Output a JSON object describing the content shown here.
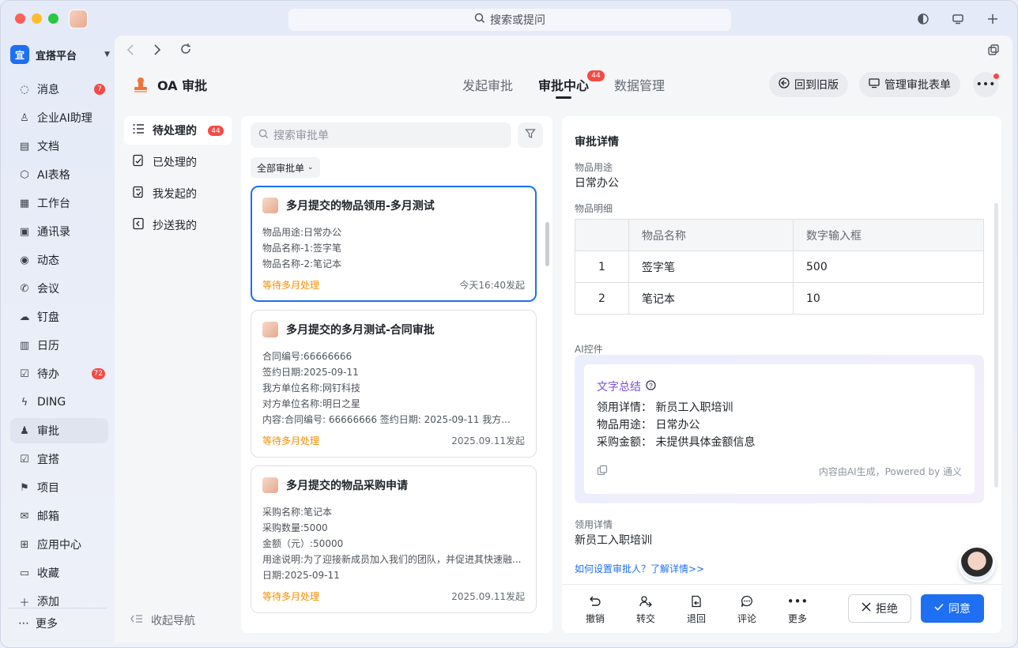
{
  "titlebar": {
    "search_placeholder": "搜索或提问"
  },
  "org": {
    "logo_char": "宜",
    "name": "宜搭平台"
  },
  "sidebar": {
    "items": [
      {
        "label": "消息",
        "icon": "chat-icon",
        "badge": "7"
      },
      {
        "label": "企业AI助理",
        "icon": "person-icon",
        "badge": ""
      },
      {
        "label": "文档",
        "icon": "doc-icon",
        "badge": ""
      },
      {
        "label": "AI表格",
        "icon": "cube-icon",
        "badge": ""
      },
      {
        "label": "工作台",
        "icon": "grid-icon",
        "badge": ""
      },
      {
        "label": "通讯录",
        "icon": "contacts-icon",
        "badge": ""
      },
      {
        "label": "动态",
        "icon": "eye-icon",
        "badge": ""
      },
      {
        "label": "会议",
        "icon": "phone-icon",
        "badge": ""
      },
      {
        "label": "钉盘",
        "icon": "cloud-icon",
        "badge": ""
      },
      {
        "label": "日历",
        "icon": "calendar-icon",
        "badge": ""
      },
      {
        "label": "待办",
        "icon": "check-icon",
        "badge": "72"
      },
      {
        "label": "DING",
        "icon": "bolt-icon",
        "badge": ""
      },
      {
        "label": "审批",
        "icon": "stamp-icon",
        "badge": ""
      },
      {
        "label": "宜搭",
        "icon": "checkbox-icon",
        "badge": ""
      },
      {
        "label": "项目",
        "icon": "flag-icon",
        "badge": ""
      },
      {
        "label": "邮箱",
        "icon": "mail-icon",
        "badge": ""
      },
      {
        "label": "应用中心",
        "icon": "apps-icon",
        "badge": ""
      },
      {
        "label": "收藏",
        "icon": "box-icon",
        "badge": ""
      },
      {
        "label": "添加",
        "icon": "plus-icon",
        "badge": ""
      }
    ],
    "more_label": "更多"
  },
  "app": {
    "title": "OA 审批",
    "tabs": [
      {
        "label": "发起审批"
      },
      {
        "label": "审批中心",
        "badge": "44"
      },
      {
        "label": "数据管理"
      }
    ],
    "back_old_label": "回到旧版",
    "manage_forms_label": "管理审批表单"
  },
  "subnav": {
    "items": [
      {
        "label": "待处理的",
        "badge": "44"
      },
      {
        "label": "已处理的"
      },
      {
        "label": "我发起的"
      },
      {
        "label": "抄送我的"
      }
    ],
    "collapse_label": "收起导航"
  },
  "list": {
    "search_placeholder": "搜索审批单",
    "filter_label": "全部审批单",
    "cards": [
      {
        "title": "多月提交的物品领用-多月测试",
        "lines": [
          "物品用途:日常办公",
          "物品名称-1:签字笔",
          "物品名称-2:笔记本"
        ],
        "status": "等待多月处理",
        "time": "今天16:40发起"
      },
      {
        "title": "多月提交的多月测试-合同审批",
        "lines": [
          "合同编号:66666666",
          "签约日期:2025-09-11",
          "我方单位名称:网钉科技",
          "对方单位名称:明日之星",
          "内容:合同编号: 66666666 签约日期: 2025-09-11 我方..."
        ],
        "status": "等待多月处理",
        "time": "2025.09.11发起"
      },
      {
        "title": "多月提交的物品采购申请",
        "lines": [
          "采购名称:笔记本",
          "采购数量:5000",
          "金额（元）:50000",
          "用途说明:为了迎接新成员加入我们的团队，并促进其快速融...",
          "日期:2025-09-11"
        ],
        "status": "等待多月处理",
        "time": "2025.09.11发起"
      }
    ]
  },
  "detail": {
    "heading": "审批详情",
    "usage_label": "物品用途",
    "usage_value": "日常办公",
    "items_label": "物品明细",
    "table": {
      "headers": [
        "",
        "物品名称",
        "数字输入框"
      ],
      "rows": [
        [
          "1",
          "签字笔",
          "500"
        ],
        [
          "2",
          "笔记本",
          "10"
        ]
      ]
    },
    "ai_label": "AI控件",
    "ai": {
      "title": "文字总结",
      "lines": [
        "领用详情： 新员工入职培训",
        "物品用途： 日常办公",
        "采购金额： 未提供具体金额信息"
      ],
      "powered": "内容由AI生成，Powered by 通义"
    },
    "receive_label": "领用详情",
    "receive_value": "新员工入职培训",
    "help_link": "如何设置审批人？了解详情>>",
    "actions": [
      {
        "label": "撤销",
        "icon": "undo-icon"
      },
      {
        "label": "转交",
        "icon": "transfer-icon"
      },
      {
        "label": "退回",
        "icon": "return-icon"
      },
      {
        "label": "评论",
        "icon": "comment-icon"
      },
      {
        "label": "更多",
        "icon": "more-icon"
      }
    ],
    "reject_label": "拒绝",
    "agree_label": "同意"
  }
}
